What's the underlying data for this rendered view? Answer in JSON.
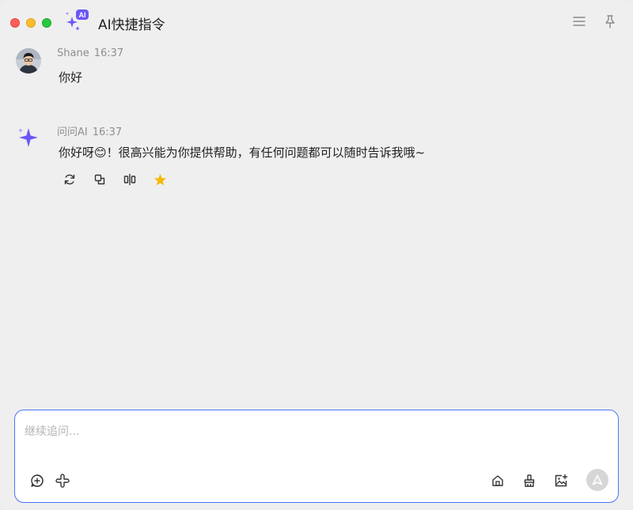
{
  "app": {
    "title": "AI快捷指令"
  },
  "messages": [
    {
      "sender": "Shane",
      "time": "16:37",
      "text": "你好"
    },
    {
      "sender": "问问AI",
      "time": "16:37",
      "text": "你好呀😊！很高兴能为你提供帮助，有任何问题都可以随时告诉我哦~"
    }
  ],
  "composer": {
    "placeholder": "继续追问..."
  },
  "colors": {
    "accent": "#4b73ff",
    "ai_purple": "#6b57f5",
    "star": "#f5b800"
  },
  "icons": [
    "menu-icon",
    "pin-icon",
    "refresh-icon",
    "copy-icon",
    "compare-icon",
    "star-icon",
    "new-chat-icon",
    "plugin-icon",
    "home-icon",
    "clean-icon",
    "image-upload-icon",
    "send-icon"
  ]
}
